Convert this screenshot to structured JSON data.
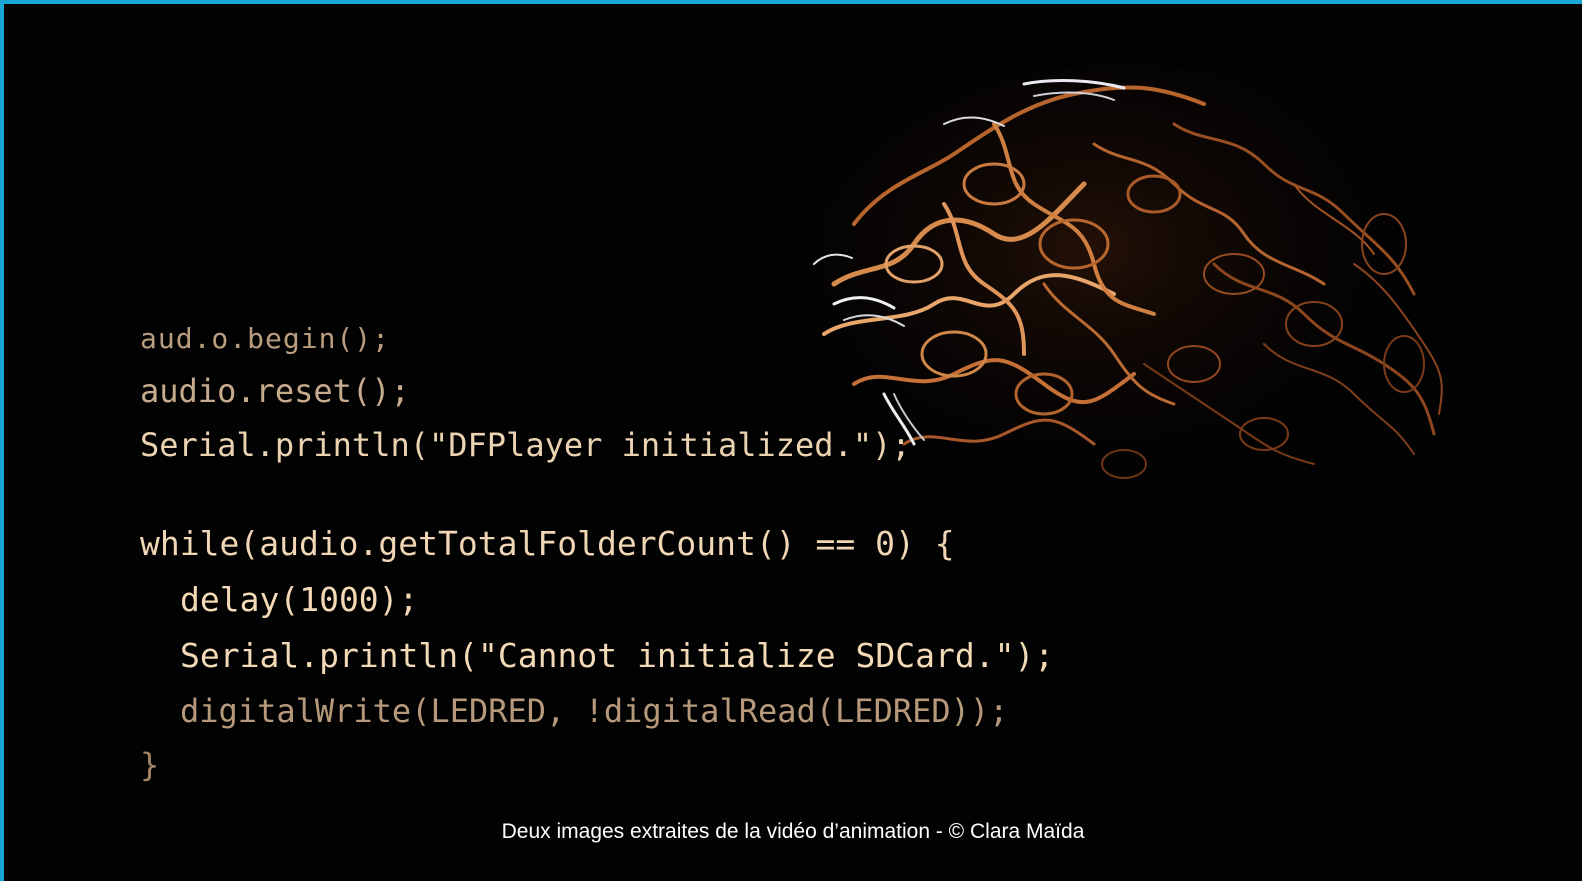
{
  "code": {
    "line1": "aud.o.begin();",
    "line2": "audio.reset();",
    "line3": "Serial.println(\"DFPlayer initialized.\");",
    "line4": "while(audio.getTotalFolderCount() == 0) {",
    "line5": "delay(1000);",
    "line6": "Serial.println(\"Cannot initialize SDCard.\");",
    "line7": "digitalWrite(LEDRED, !digitalRead(LEDRED));",
    "line8": "}"
  },
  "caption": "Deux images extraites de la vidéo d’animation - © Clara Maïda",
  "colors": {
    "frame_border": "#19a6d6",
    "background": "#020203",
    "code_text": "#f0d6b4",
    "blob_copper": "#c8763e"
  }
}
